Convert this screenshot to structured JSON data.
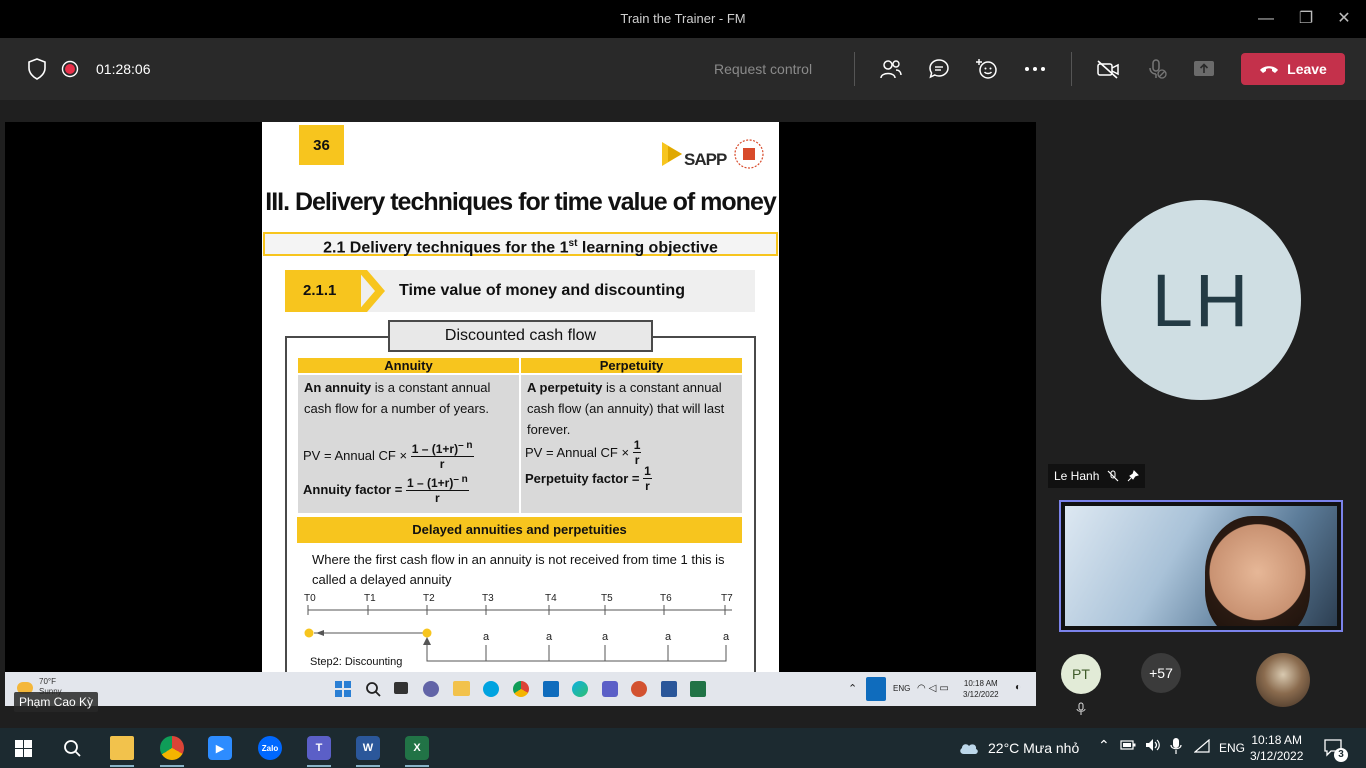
{
  "window": {
    "title": "Train the Trainer - FM"
  },
  "toolbar": {
    "timer": "01:28:06",
    "request_control": "Request control",
    "leave_label": "Leave"
  },
  "slide": {
    "number": "36",
    "logo_text": "SAPP",
    "title": "III. Delivery techniques for time value of money",
    "subtitle_main": "2.1 Delivery techniques for the 1",
    "subtitle_sup": "st",
    "subtitle_end": " learning objective",
    "section_num": "2.1.1",
    "section_title": "Time value of money and discounting",
    "box_title": "Discounted cash flow",
    "annuity": {
      "heading": "Annuity",
      "bold": "An annuity",
      "text": " is a constant annual cash flow for a number of years.",
      "pv_label": "PV = Annual CF ×",
      "factor_label": "Annuity factor =",
      "frac_num": "1 – (1+r)",
      "frac_exp": "– n",
      "frac_den": "r"
    },
    "perpetuity": {
      "heading": "Perpetuity",
      "bold": "A perpetuity",
      "text": " is a constant annual cash flow (an annuity) that will last forever.",
      "pv_label": "PV = Annual CF ×",
      "factor_label": "Perpetuity factor =",
      "frac_num": "1",
      "frac_den": "r"
    },
    "delayed_heading": "Delayed annuities and perpetuities",
    "delayed_text": "Where the first cash flow in an annuity is not received from time 1 this is called a delayed annuity",
    "timeline_ticks": [
      "T0",
      "T1",
      "T2",
      "T3",
      "T4",
      "T5",
      "T6",
      "T7"
    ],
    "timeline_labels": [
      "a",
      "a",
      "a",
      "a",
      "a"
    ],
    "step2": "Step2:   Discounting"
  },
  "inner_taskbar": {
    "weather_temp": "70°F",
    "weather_cond": "Sunny",
    "lang": "ENG",
    "time": "10:18 AM",
    "date": "3/12/2022"
  },
  "presenter_name": "Phạm Cao Kỳ",
  "participants": {
    "lh_initials": "LH",
    "lh_name": "Le Hanh",
    "pt_initials": "PT",
    "more_count": "+57"
  },
  "taskbar": {
    "weather": "22°C  Mưa nhỏ",
    "lang": "ENG",
    "time": "10:18 AM",
    "date": "3/12/2022",
    "notif_count": "3",
    "zalo": "Zalo"
  },
  "colors": {
    "leave": "#c4314b",
    "slide_accent": "#f7c51e",
    "teams_toolbar": "#292929"
  }
}
